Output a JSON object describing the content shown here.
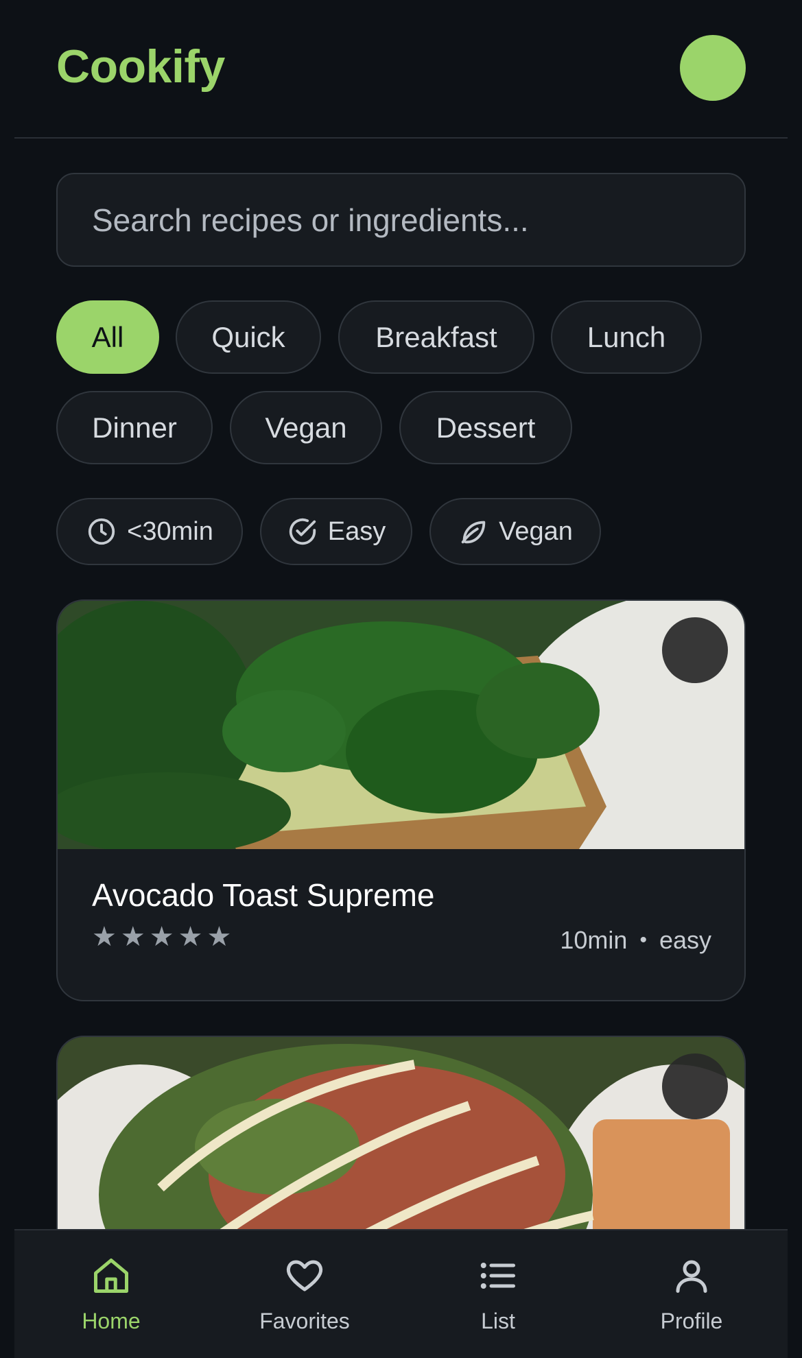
{
  "app": {
    "brand": "Cookify",
    "accent": "#9bd46a",
    "background": "#0d1116"
  },
  "header": {
    "avatar_icon": "avatar-circle"
  },
  "search": {
    "placeholder": "Search recipes or ingredients..."
  },
  "categories": [
    {
      "label": "All",
      "active": true
    },
    {
      "label": "Quick",
      "active": false
    },
    {
      "label": "Breakfast",
      "active": false
    },
    {
      "label": "Lunch",
      "active": false
    },
    {
      "label": "Dinner",
      "active": false
    },
    {
      "label": "Vegan",
      "active": false
    },
    {
      "label": "Dessert",
      "active": false
    }
  ],
  "filters": [
    {
      "label": "<30min",
      "icon": "clock-icon"
    },
    {
      "label": "Easy",
      "icon": "check-circle-icon"
    },
    {
      "label": "Vegan",
      "icon": "leaf-icon"
    }
  ],
  "recipes": [
    {
      "title": "Avocado Toast Supreme",
      "rating": 5,
      "time": "10min",
      "difficulty": "easy",
      "image": "avocado toast with spinach"
    },
    {
      "title": "",
      "image": "caesar salad with dressing"
    }
  ],
  "bottom_nav": [
    {
      "label": "Home",
      "icon": "home-icon",
      "active": true
    },
    {
      "label": "Favorites",
      "icon": "heart-icon",
      "active": false
    },
    {
      "label": "List",
      "icon": "list-icon",
      "active": false
    },
    {
      "label": "Profile",
      "icon": "user-icon",
      "active": false
    }
  ]
}
